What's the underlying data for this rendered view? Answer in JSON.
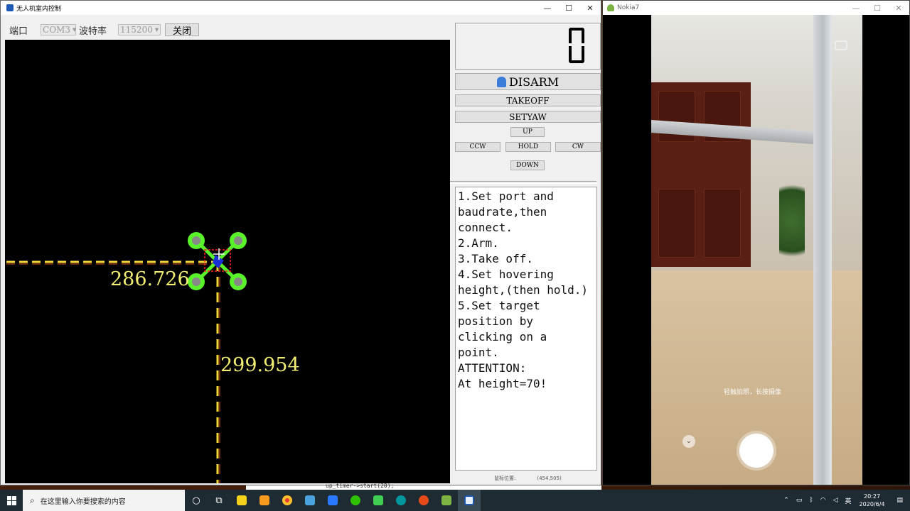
{
  "app": {
    "title": "无人机室内控制",
    "window_buttons": {
      "minimize": "—",
      "maximize": "☐",
      "close": "✕"
    }
  },
  "toolbar": {
    "port_label": "端口",
    "port_value": "COM3",
    "baud_label": "波特率",
    "baud_value": "115200",
    "close_button": "关闭"
  },
  "canvas": {
    "x_readout": "286.726",
    "y_readout": "299.954"
  },
  "controls": {
    "disarm": "DISARM",
    "takeoff": "TAKEOFF",
    "setyaw": "SETYAW",
    "up": "UP",
    "ccw": "CCW",
    "hold": "HOLD",
    "cw": "CW",
    "down": "DOWN"
  },
  "instructions": [
    "1.Set port and baudrate,then connect.",
    "2.Arm.",
    "3.Take off.",
    "4.Set hovering height,(then hold.)",
    "5.Set target position by clicking on a point.",
    "ATTENTION:",
    "At height=70!"
  ],
  "status": {
    "mouse_label": "鼠标位置:",
    "mouse_value": "(454,505)"
  },
  "phone": {
    "title": "Nokia7",
    "camera_hint": "轻触拍照，长按摄像"
  },
  "editor": {
    "code_fragment": "up_timer->start(20);"
  },
  "taskbar": {
    "search_placeholder": "在这里输入你要搜索的内容",
    "ime": "英",
    "time": "20:27",
    "date": "2020/6/4"
  },
  "colors": {
    "drone_arm": "#5af22a",
    "crosshair_line": "#f2d838",
    "readout_text": "#f2ee74",
    "target_box": "#ff2020"
  }
}
